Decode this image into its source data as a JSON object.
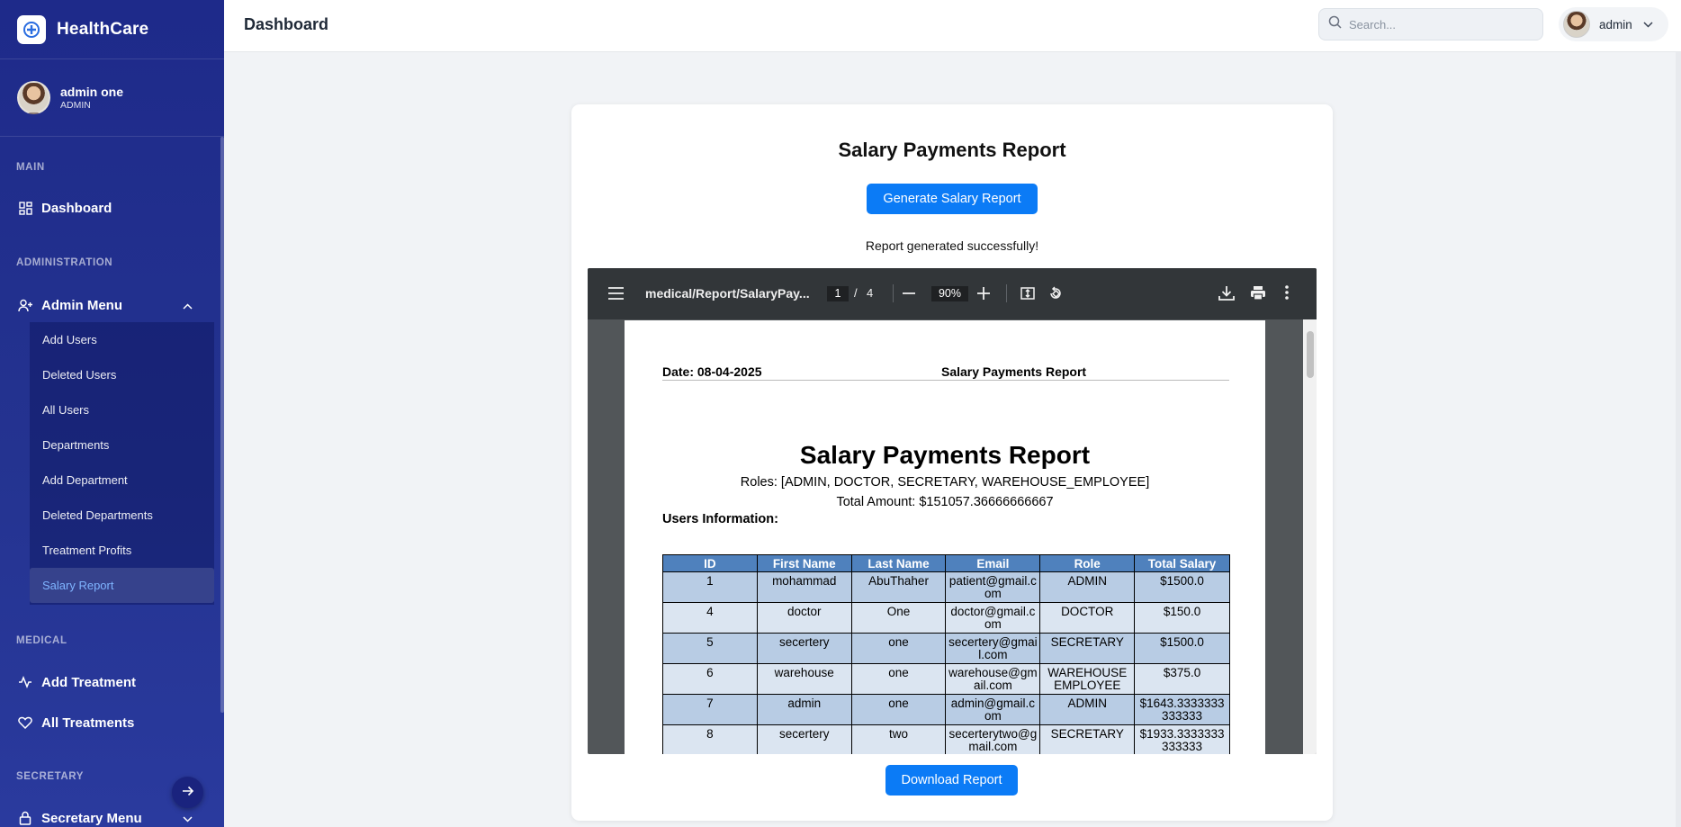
{
  "app": {
    "name": "HealthCare"
  },
  "user": {
    "name": "admin one",
    "role": "ADMIN"
  },
  "sidebar": {
    "sections": {
      "main": "MAIN",
      "administration": "ADMINISTRATION",
      "medical": "MEDICAL",
      "secretary": "SECRETARY"
    },
    "dashboard": "Dashboard",
    "admin_menu": "Admin Menu",
    "admin_items": [
      "Add Users",
      "Deleted Users",
      "All Users",
      "Departments",
      "Add Department",
      "Deleted Departments",
      "Treatment Profits",
      "Salary Report"
    ],
    "active_item": "Salary Report",
    "add_treatment": "Add Treatment",
    "all_treatments": "All Treatments",
    "secretary_menu": "Secretary Menu"
  },
  "header": {
    "title": "Dashboard",
    "search_placeholder": "Search...",
    "profile_name": "admin"
  },
  "report": {
    "title": "Salary Payments Report",
    "generate_label": "Generate Salary Report",
    "success_message": "Report generated successfully!",
    "download_label": "Download Report"
  },
  "pdf_viewer": {
    "file_name": "medical/Report/SalaryPay...",
    "current_page": "1",
    "page_separator": "/",
    "total_pages": "4",
    "zoom": "90%",
    "page": {
      "date": "Date: 08-04-2025",
      "header_title": "Salary Payments Report",
      "title": "Salary Payments Report",
      "roles": "Roles: [ADMIN, DOCTOR, SECRETARY, WAREHOUSE_EMPLOYEE]",
      "total_amount": "Total Amount: $151057.36666666667",
      "users_heading": "Users Information:",
      "table": {
        "headers": [
          "ID",
          "First Name",
          "Last Name",
          "Email",
          "Role",
          "Total Salary"
        ],
        "rows": [
          [
            "1",
            "mohammad",
            "AbuThaher",
            "patient@gmail.com",
            "ADMIN",
            "$1500.0"
          ],
          [
            "4",
            "doctor",
            "One",
            "doctor@gmail.com",
            "DOCTOR",
            "$150.0"
          ],
          [
            "5",
            "secertery",
            "one",
            "secertery@gmail.com",
            "SECRETARY",
            "$1500.0"
          ],
          [
            "6",
            "warehouse",
            "one",
            "warehouse@gmail.com",
            "WAREHOUSE EMPLOYEE",
            "$375.0"
          ],
          [
            "7",
            "admin",
            "one",
            "admin@gmail.com",
            "ADMIN",
            "$1643.3333333333333"
          ],
          [
            "8",
            "secertery",
            "two",
            "secerterytwo@gmail.com",
            "SECRETARY",
            "$1933.3333333333333"
          ]
        ]
      }
    }
  },
  "colors": {
    "sidebar_top": "#1e2a8a",
    "sidebar_bottom": "#2a3a9e",
    "primary_button": "#0b7bf6",
    "active_link": "#7fb4ff",
    "table_header": "#4f81bd",
    "table_row_odd": "#b8cce4",
    "table_row_even": "#dbe5f1"
  },
  "icons": {
    "brand": "medical-logo-icon",
    "dashboard": "grid-icon",
    "admin_menu": "user-plus-icon",
    "add_treatment": "activity-icon",
    "all_treatments": "heart-icon",
    "secretary_menu": "lock-icon",
    "search": "search-icon",
    "fab": "arrow-right-icon"
  }
}
